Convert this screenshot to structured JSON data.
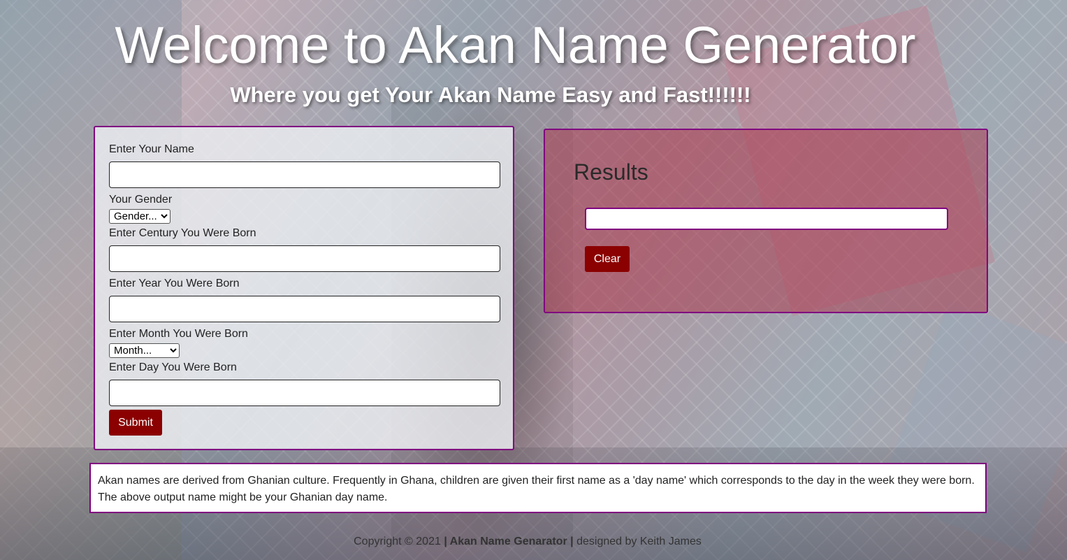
{
  "header": {
    "title": "Welcome to Akan Name Generator",
    "subtitle": "Where you get Your Akan Name Easy and Fast!!!!!!"
  },
  "form": {
    "name_label": "Enter Your Name",
    "name_value": "",
    "gender_label": "Your Gender",
    "gender_selected": "Gender...",
    "century_label": "Enter Century You Were Born",
    "century_value": "",
    "year_label": "Enter Year You Were Born",
    "year_value": "",
    "month_label": "Enter Month You Were Born",
    "month_selected": "Month...",
    "day_label": "Enter Day You Were Born",
    "day_value": "",
    "submit_label": "Submit"
  },
  "results": {
    "title": "Results",
    "output_value": "",
    "clear_label": "Clear"
  },
  "info": {
    "text": "Akan names are derived from Ghanian culture. Frequently in Ghana, children are given their first name as a 'day name' which corresponds to the day in the week they were born. The above output name might be your Ghanian day name."
  },
  "footer": {
    "copyright": "Copyright © 2021",
    "separator1": " | ",
    "brand": "Akan Name Genarator",
    "separator2": " | ",
    "credit": "designed by Keith James"
  },
  "colors": {
    "accent_border": "#800080",
    "button_bg": "#8b0000",
    "title_text": "#ffffff"
  }
}
